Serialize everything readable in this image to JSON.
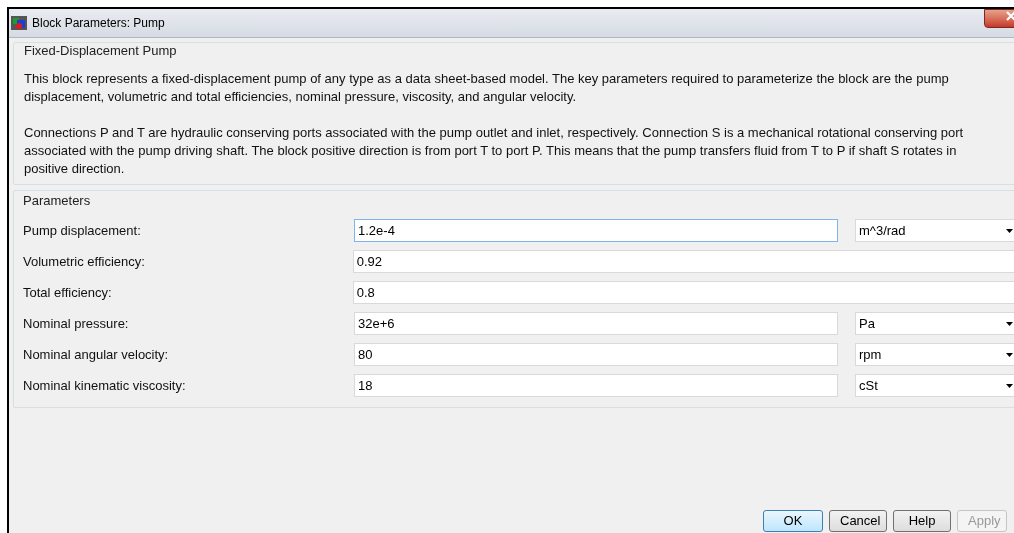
{
  "window": {
    "title": "Block Parameters: Pump"
  },
  "description": {
    "title": "Fixed-Displacement Pump",
    "paragraphs": [
      "This block represents a  fixed-displacement pump of any type as a data sheet-based model. The key parameters required to parameterize the block are the pump displacement, volumetric and total efficiencies, nominal pressure, viscosity, and angular velocity.",
      "Connections P and T are hydraulic conserving ports associated with the pump outlet and inlet, respectively. Connection S is a mechanical rotational conserving port associated with the pump driving shaft. The block positive direction is from port T to port P. This means that the pump transfers fluid from T to P if shaft S rotates in positive direction."
    ]
  },
  "parameters": {
    "title": "Parameters",
    "rows": [
      {
        "label": "Pump displacement:",
        "value": "1.2e-4",
        "unit": "m^3/rad",
        "focused": true
      },
      {
        "label": "Volumetric efficiency:",
        "value": "0.92",
        "focused": false
      },
      {
        "label": "Total efficiency:",
        "value": "0.8",
        "focused": false
      },
      {
        "label": "Nominal pressure:",
        "value": "32e+6",
        "unit": "Pa",
        "focused": false
      },
      {
        "label": "Nominal angular velocity:",
        "value": "80",
        "unit": "rpm",
        "focused": false
      },
      {
        "label": "Nominal kinematic viscosity:",
        "value": "18",
        "unit": "cSt",
        "focused": false
      }
    ]
  },
  "buttons": [
    {
      "label": "OK",
      "default": true,
      "disabled": false
    },
    {
      "label": "Cancel",
      "default": false,
      "disabled": false
    },
    {
      "label": "Help",
      "default": false,
      "disabled": false
    },
    {
      "label": "Apply",
      "default": false,
      "disabled": true
    }
  ]
}
